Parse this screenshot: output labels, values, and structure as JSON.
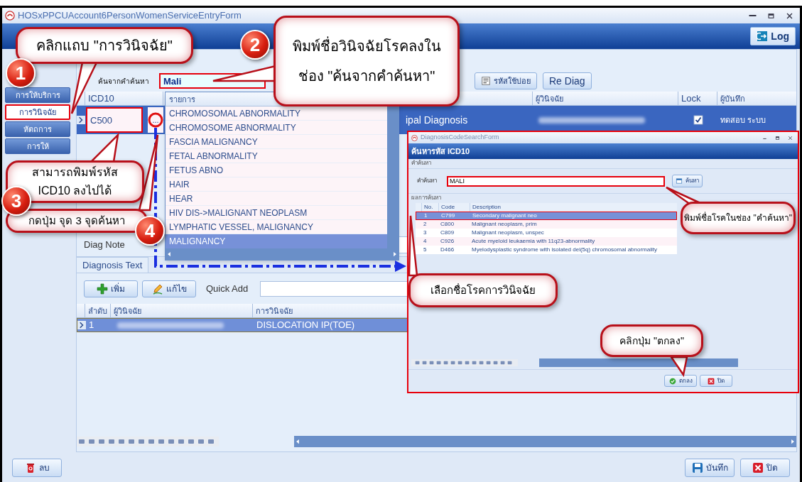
{
  "window": {
    "title": "HOSxPPCUAccount6PersonWomenServiceEntryForm"
  },
  "header": {
    "log_button": "Log"
  },
  "sidebar": {
    "items": [
      {
        "label": "การให้บริการ",
        "selected": false
      },
      {
        "label": "การวินิจฉัย",
        "selected": true
      },
      {
        "label": "หัตถการ",
        "selected": false
      },
      {
        "label": "การให้",
        "selected": false
      }
    ]
  },
  "search": {
    "label": "ค้นจากคำค้นหา",
    "value": "Mali",
    "buttons": [
      {
        "label": "รหัสใช้บ่อย",
        "kind": "icon"
      },
      {
        "label": "Re Diag",
        "kind": "plain"
      }
    ]
  },
  "diagnosis_grid": {
    "columns": [
      "ICD10",
      "ผู้วินิจฉัย",
      "Lock",
      "ผู้บันทึก"
    ],
    "rows": [
      {
        "icd10": "C500",
        "button": "...",
        "type": "ipal Diagnosis",
        "lock": true,
        "recorder": "ทดสอบ ระบบ",
        "selected": true
      }
    ]
  },
  "notes": {
    "diag_note_label": "Diag Note"
  },
  "dropdown": {
    "header": "รายการ",
    "items": [
      {
        "label": "CHROMOSOMAL ABNORMALITY",
        "selected": false
      },
      {
        "label": "CHROMOSOME ABNORMALITY",
        "selected": false
      },
      {
        "label": "FASCIA MALIGNANCY",
        "selected": false
      },
      {
        "label": "FETAL ABNORMALITY",
        "selected": false
      },
      {
        "label": "FETUS ABNO",
        "selected": false
      },
      {
        "label": "HAIR",
        "selected": false
      },
      {
        "label": "HEAR",
        "selected": false
      },
      {
        "label": "HIV DIS->MALIGNANT NEOPLASM",
        "selected": false
      },
      {
        "label": "LYMPHATIC VESSEL, MALIGNANCY",
        "selected": false
      },
      {
        "label": "MALIGNANCY",
        "selected": true
      }
    ]
  },
  "diagnosis_text": {
    "tab": "Diagnosis Text",
    "buttons": [
      {
        "label": "เพิ่ม",
        "kind": "add"
      },
      {
        "label": "แก้ไข",
        "kind": "edit"
      }
    ],
    "quick_add_label": "Quick Add",
    "columns": [
      "ลำดับ",
      "ผู้วินิจฉัย",
      "การวินิจฉัย"
    ],
    "rows": [
      {
        "no": "1",
        "diagnosis": "DISLOCATION IP(TOE)",
        "selected": true
      }
    ]
  },
  "footer": {
    "buttons": [
      {
        "label": "ลบ",
        "kind": "delete"
      },
      {
        "label": "บันทึก",
        "kind": "save"
      },
      {
        "label": "ปิด",
        "kind": "close"
      }
    ]
  },
  "dialog": {
    "title": "DiagnosisCodeSearchForm",
    "header": "ค้นหารหัส ICD10",
    "search_group": "คำค้นหา",
    "search_label": "คำค้นหา",
    "search_value": "MALI",
    "search_button": "ค้นหา",
    "results_group": "ผลการค้นหา",
    "columns": [
      "No.",
      "Code",
      "Description"
    ],
    "rows": [
      {
        "no": "1",
        "code": "C799",
        "description": "Secondary malignant neo",
        "selected": true
      },
      {
        "no": "2",
        "code": "C800",
        "description": "Malignant neoplasm, prim",
        "selected": false
      },
      {
        "no": "3",
        "code": "C809",
        "description": "Malignant neoplasm, unspec",
        "selected": false
      },
      {
        "no": "4",
        "code": "C926",
        "description": "Acute myeloid leukaemia with 11q23-abnormality",
        "selected": false
      },
      {
        "no": "5",
        "code": "D466",
        "description": "Myelodysplastic syndrome with isolated del(5q) chromosomal abnormality",
        "selected": false
      }
    ],
    "buttons": [
      {
        "label": "ตกลง",
        "kind": "ok"
      },
      {
        "label": "ปิด",
        "kind": "close"
      }
    ]
  },
  "callouts": [
    {
      "text": "คลิกแถบ \"การวินิจฉัย\"",
      "badge": "1"
    },
    {
      "text": "พิมพ์ชื่อวินิจฉัยโรคลงใน\nช่อง \"ค้นจากคำค้นหา\"",
      "badge": "2"
    },
    {
      "text": "สามารถพิมพ์รหัส\nICD10 ลงไปได้",
      "badge": "3"
    },
    {
      "text": "กดปุ่ม จุด 3 จุดค้นหา",
      "badge": "4"
    },
    {
      "text": "พิมพ์ชื่อโรคในช่อง \"คำค้นหา\""
    },
    {
      "text": "เลือกชื่อโรคการวินิจฉัย"
    },
    {
      "text": "คลิกปุ่ม \"ตกลง\""
    }
  ]
}
